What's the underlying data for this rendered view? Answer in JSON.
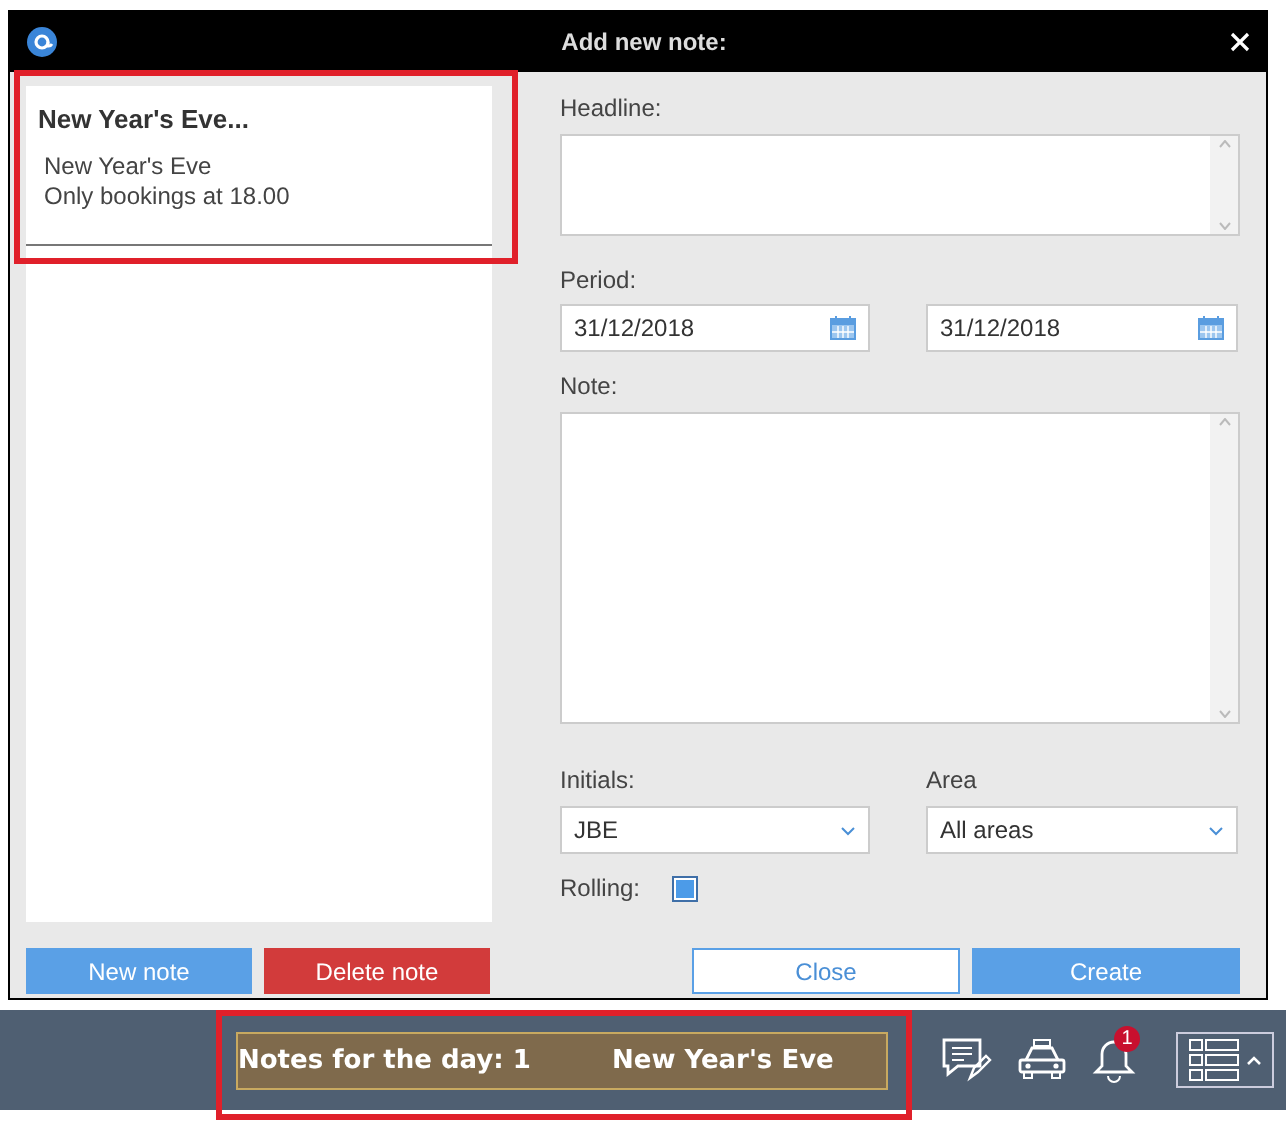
{
  "window": {
    "title": "Add new note:"
  },
  "notes_list": [
    {
      "title": "New Year's Eve...",
      "lines": [
        "New Year's Eve",
        "Only bookings at 18.00"
      ],
      "selected": true
    }
  ],
  "list_buttons": [
    {
      "label": "New note",
      "kind": "primary"
    },
    {
      "label": "Delete note",
      "kind": "danger"
    }
  ],
  "form": {
    "headline_label": "Headline:",
    "period_label": "Period:",
    "period_from": "31/12/2018",
    "period_to": "31/12/2018",
    "note_label": "Note:",
    "initials_label": "Initials:",
    "initials_value": "JBE",
    "area_label": "Area",
    "area_value": "All areas",
    "rolling_label": "Rolling:",
    "rolling_checked": true
  },
  "form_buttons": [
    {
      "label": "Close",
      "kind": "outline"
    },
    {
      "label": "Create",
      "kind": "primary"
    }
  ],
  "status_bar": {
    "notes_count": "Notes for the day: 1",
    "note_title": "New Year's Eve",
    "notification_badge": "1"
  }
}
